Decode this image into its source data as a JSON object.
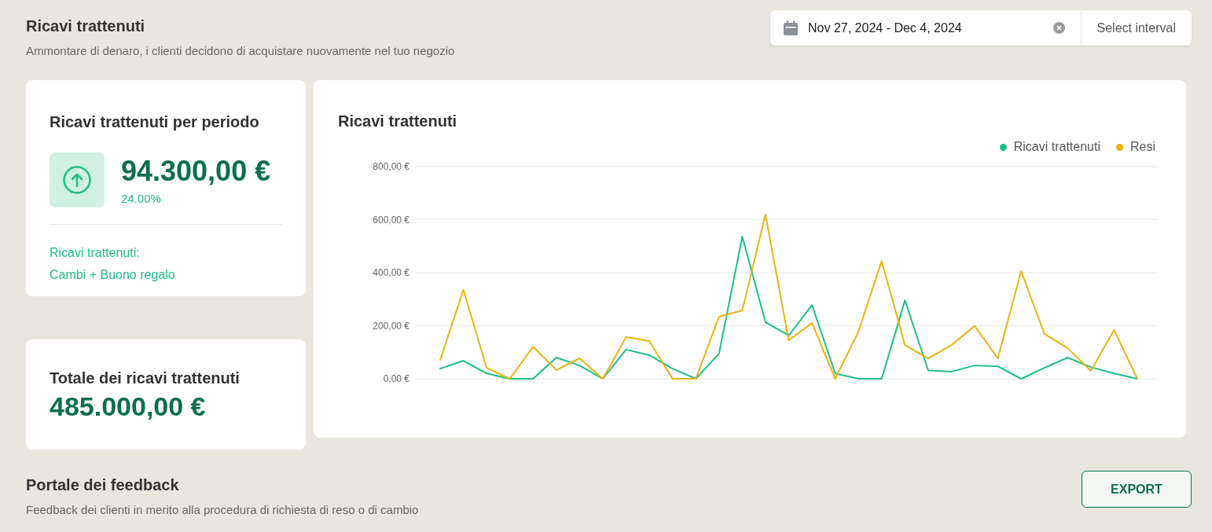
{
  "header": {
    "title": "Ricavi trattenuti",
    "subtitle": "Ammontare di denaro, i clienti decidono di acquistare nuovamente nel tuo negozio"
  },
  "date_range": {
    "value": "Nov 27, 2024 - Dec 4, 2024",
    "button": "Select interval"
  },
  "period_card": {
    "title": "Ricavi trattenuti per periodo",
    "amount": "94.300,00 €",
    "change": "24.00%",
    "note_label": "Ricavi trattenuti:",
    "note_value": "Cambi + Buono regalo"
  },
  "total_card": {
    "title": "Totale dei ricavi trattenuti",
    "amount": "485.000,00 €"
  },
  "chart_card": {
    "title": "Ricavi trattenuti",
    "chart_data": {
      "type": "line",
      "grid": true,
      "ylim": [
        0,
        800
      ],
      "yticks": [
        {
          "value": 0,
          "label": "0,00 €"
        },
        {
          "value": 200,
          "label": "200,00 €"
        },
        {
          "value": 400,
          "label": "400,00 €"
        },
        {
          "value": 600,
          "label": "600,00 €"
        },
        {
          "value": 800,
          "label": "800,00 €"
        }
      ],
      "series": [
        {
          "name": "Ricavi trattenuti",
          "color": "#1dbf86",
          "values": [
            38,
            68,
            20,
            0,
            0,
            80,
            50,
            0,
            110,
            89,
            38,
            0,
            95,
            536,
            213,
            163,
            278,
            20,
            0,
            0,
            296,
            32,
            27,
            50,
            47,
            0,
            41,
            80,
            44,
            20,
            0
          ]
        },
        {
          "name": "Resi",
          "color": "#ebb30f",
          "values": [
            71,
            335,
            41,
            0,
            121,
            33,
            77,
            0,
            157,
            142,
            0,
            0,
            234,
            258,
            619,
            145,
            210,
            0,
            178,
            444,
            127,
            77,
            127,
            199,
            77,
            406,
            169,
            116,
            30,
            184,
            0
          ]
        }
      ]
    }
  },
  "feedback": {
    "title": "Portale dei feedback",
    "subtitle": "Feedback dei clienti in merito alla procedura di richiesta di reso o di cambio",
    "button": "EXPORT"
  }
}
